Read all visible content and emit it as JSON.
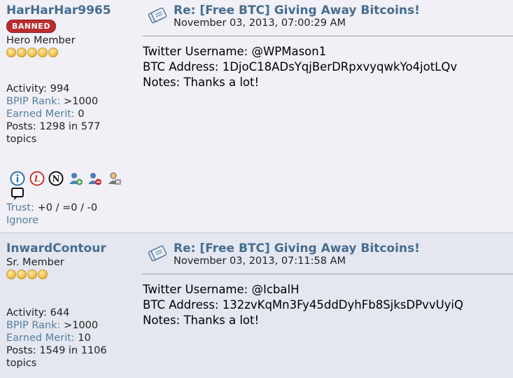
{
  "posts": [
    {
      "username": "HarHarHar9965",
      "badge": "BANNED",
      "rank": "Hero Member",
      "coin_count": 5,
      "activity": "Activity: 994",
      "bpip_label": "BPIP Rank:",
      "bpip_value": ">1000",
      "merit_label": "Earned Merit:",
      "merit_value": "0",
      "posts": "Posts: 1298 in 577",
      "topics": "topics",
      "trust_label": "Trust:",
      "trust_value": "+0 / =0 / -0",
      "ignore": "Ignore",
      "subject": "Re: [Free BTC] Giving Away Bitcoins!",
      "timestamp": "November 03, 2013, 07:00:29 AM",
      "body": [
        "Twitter Username: @WPMason1",
        "BTC Address: 1DjoC18ADsYqjBerDRpxvyqwkYo4jotLQv",
        "Notes: Thanks a lot!"
      ]
    },
    {
      "username": "InwardContour",
      "rank": "Sr. Member",
      "coin_count": 4,
      "activity": "Activity: 644",
      "bpip_label": "BPIP Rank:",
      "bpip_value": ">1000",
      "merit_label": "Earned Merit:",
      "merit_value": "10",
      "posts": "Posts: 1549 in 1106",
      "topics": "topics",
      "subject": "Re: [Free BTC] Giving Away Bitcoins!",
      "timestamp": "November 03, 2013, 07:11:58 AM",
      "body": [
        "Twitter Username: @IcbalH",
        "BTC Address: 132zvKqMn3Fy45ddDyhFb8SjksDPvvUyiQ",
        "Notes: Thanks a lot!"
      ]
    }
  ],
  "icons": [
    "info-icon",
    "ledger-icon",
    "ninja-icon",
    "add-buddy-icon",
    "remove-buddy-icon",
    "user-icon",
    "message-icon"
  ],
  "colors": {
    "link": "#476c8e",
    "label": "#557ea0",
    "banned": "#bb2d2d",
    "post1_bg": "#f0f0f6",
    "post2_bg": "#e4e7f0"
  }
}
